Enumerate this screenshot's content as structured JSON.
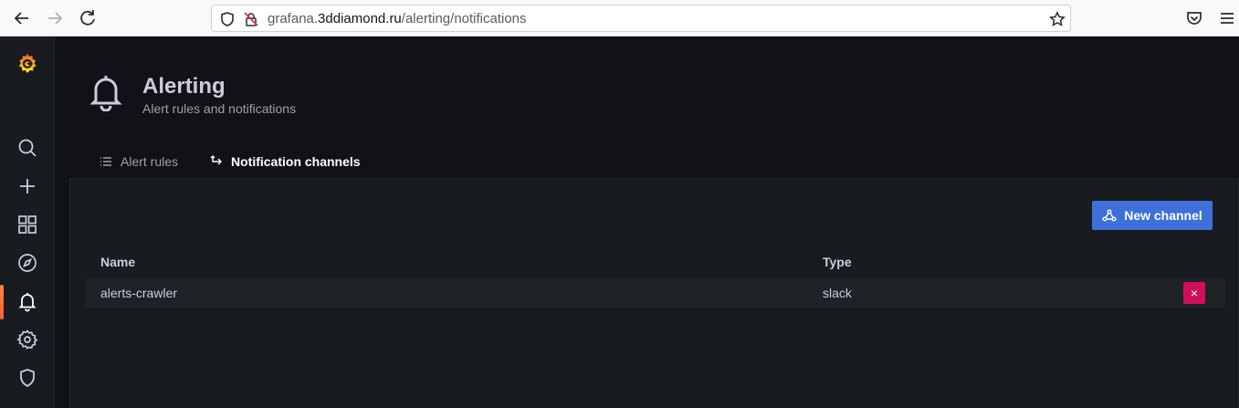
{
  "browser": {
    "url_prefix": "grafana.",
    "url_host": "3ddiamond.ru",
    "url_path": "/alerting/notifications",
    "icons": [
      "back-icon",
      "forward-icon",
      "reload-icon",
      "shield-icon",
      "lock-insecure-icon",
      "bookmark-star-icon",
      "pocket-icon",
      "menu-icon"
    ]
  },
  "sidemenu": {
    "items": [
      "grafana-logo",
      "search-icon",
      "create-icon",
      "dashboards-icon",
      "explore-icon",
      "alerting-icon",
      "configuration-icon",
      "server-admin-icon"
    ],
    "active": "alerting-icon"
  },
  "header": {
    "title": "Alerting",
    "subtitle": "Alert rules and notifications"
  },
  "tabs": [
    {
      "label": "Alert rules",
      "icon": "list-icon",
      "active": false
    },
    {
      "label": "Notification channels",
      "icon": "channel-icon",
      "active": true
    }
  ],
  "toolbar": {
    "new_channel_label": "New channel"
  },
  "table": {
    "columns": [
      "Name",
      "Type"
    ],
    "rows": [
      {
        "name": "alerts-crawler",
        "type": "slack",
        "delete_label": "×"
      }
    ]
  },
  "colors": {
    "accent_gradient_start": "#ff8833",
    "accent_gradient_end": "#f55f3e",
    "primary_button": "#3d71d9",
    "destructive_button": "#d10e5c",
    "background": "#111217",
    "panel": "#181b1f"
  }
}
